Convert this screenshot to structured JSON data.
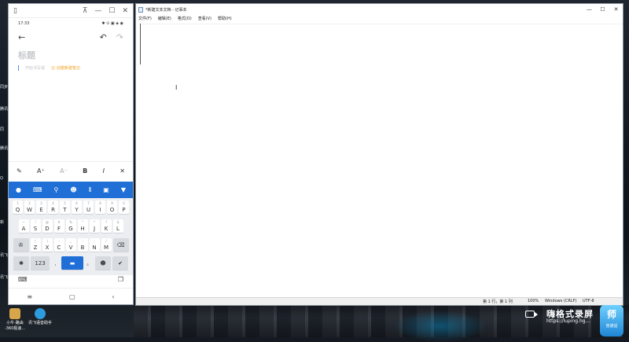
{
  "phone": {
    "window_title": "",
    "status_time": "17:33",
    "status_icons": "✱ ⊙ ▣ ◈ ◉",
    "toolbar": {
      "back": "←",
      "undo": "↶",
      "redo": "↷"
    },
    "note": {
      "title_placeholder": "标题",
      "body_placeholder": "开始书写或",
      "tip": "☺ 创建新建笔记"
    },
    "format_bar": {
      "pen": "✎",
      "font_larger": "A⁺",
      "font_smaller": "A⁻",
      "bold": "B",
      "italic": "I",
      "close": "✕"
    },
    "ime_bar": {
      "logo": "●",
      "keyboard": "⌨",
      "search": "⚲",
      "emoji": "☻",
      "voice": "⦀",
      "clipboard": "▣",
      "collapse": "▼"
    },
    "keyboard": {
      "row1": [
        {
          "k": "Q",
          "s": "1"
        },
        {
          "k": "W",
          "s": "2"
        },
        {
          "k": "E",
          "s": "3"
        },
        {
          "k": "R",
          "s": "4"
        },
        {
          "k": "T",
          "s": "5"
        },
        {
          "k": "Y",
          "s": "6"
        },
        {
          "k": "U",
          "s": "7"
        },
        {
          "k": "I",
          "s": "8"
        },
        {
          "k": "O",
          "s": "9"
        },
        {
          "k": "P",
          "s": "0"
        }
      ],
      "row2": [
        {
          "k": "A",
          "s": "~"
        },
        {
          "k": "S",
          "s": "!"
        },
        {
          "k": "D",
          "s": "@"
        },
        {
          "k": "F",
          "s": "#"
        },
        {
          "k": "G",
          "s": "%"
        },
        {
          "k": "H",
          "s": "\""
        },
        {
          "k": "J",
          "s": "*"
        },
        {
          "k": "K",
          "s": "?"
        },
        {
          "k": "L",
          "s": "&"
        }
      ],
      "row3": [
        {
          "k": "Z",
          "s": "("
        },
        {
          "k": "X",
          "s": ")"
        },
        {
          "k": "C",
          "s": "-"
        },
        {
          "k": "V",
          "s": "_"
        },
        {
          "k": "B",
          "s": ":"
        },
        {
          "k": "N",
          "s": ";"
        },
        {
          "k": "M",
          "s": "/"
        }
      ],
      "row3_left": "✇",
      "row3_right": "⌫",
      "row4": {
        "symbol": "✱",
        "numbers": "123",
        "comma": ",",
        "space": "▬",
        "period": "。",
        "emoji": "☻",
        "enter": "✔"
      },
      "bottom_left": "⌨",
      "bottom_right": "❐"
    },
    "nav": {
      "menu": "≡",
      "home": "▢",
      "back": "‹"
    }
  },
  "notepad": {
    "title": "*新建文本文档 - 记事本",
    "controls": {
      "minimize": "—",
      "maximize": "☐",
      "close": "✕"
    },
    "menus": [
      "文件(F)",
      "编辑(E)",
      "格式(O)",
      "查看(V)",
      "帮助(H)"
    ],
    "content": "",
    "status": {
      "position": "第 1 行，第 1 列",
      "zoom": "100%",
      "eol": "Windows (CRLF)",
      "encoding": "UTF-8"
    }
  },
  "desktop": {
    "icons": [
      {
        "label": "小牛·路由 -360极速...",
        "color": "#d8a64a"
      },
      {
        "label": "讯飞语音助手",
        "color": "#2c9be0"
      }
    ],
    "side_labels": [
      "同步",
      "腾讯",
      "同",
      "腾讯",
      "Q",
      "新",
      "讯飞",
      "讯飞",
      "讯飞"
    ]
  },
  "watermark": {
    "brand": "嗨格式录屏",
    "url": "https://luping.hg...",
    "badge_big": "师",
    "badge_small": "普通话"
  }
}
